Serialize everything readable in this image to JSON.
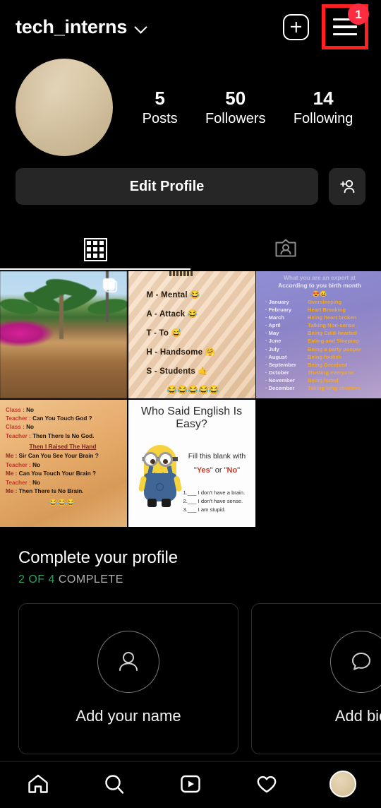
{
  "header": {
    "username": "tech_interns",
    "chevron_icon": "chevron-down-icon",
    "create_icon": "plus-square-icon",
    "menu_icon": "hamburger-menu-icon",
    "menu_badge": "1",
    "badge_color": "#ff2d41",
    "highlight_color": "#ff2020"
  },
  "profile": {
    "avatar_icon": "profile-avatar",
    "stats": [
      {
        "num": "5",
        "label": "Posts"
      },
      {
        "num": "50",
        "label": "Followers"
      },
      {
        "num": "14",
        "label": "Following"
      }
    ],
    "edit_profile_label": "Edit Profile",
    "add_person_icon": "add-person-icon"
  },
  "tabs": [
    {
      "name": "grid-tab",
      "icon": "grid-icon",
      "active": true
    },
    {
      "name": "tagged-tab",
      "icon": "person-card-icon",
      "active": false
    }
  ],
  "posts": [
    {
      "name": "post-tropical-photo",
      "type": "photo",
      "badge_icon": "carousel-icon"
    },
    {
      "name": "post-maths-acronym",
      "type": "text-meme",
      "lines": [
        "M - Mental 😂",
        "A - Attack 😂",
        "T - To 😅",
        "H - Handsome 🤗",
        "S - Students 🤙"
      ],
      "emojis": "😂😂😂😂😂"
    },
    {
      "name": "post-birth-month",
      "type": "text-meme",
      "header_line1": "What you are an expert at",
      "header_line2": "According to you birth month",
      "header_emojis": "😍😅",
      "rows": [
        {
          "month": "· January",
          "trait": "Oversleeping"
        },
        {
          "month": "· February",
          "trait": "Heart  Breaking"
        },
        {
          "month": "· March",
          "trait": "Being heart   broken"
        },
        {
          "month": "· April",
          "trait": "Talking Non-sense"
        },
        {
          "month": "· May",
          "trait": "Being Cold-hearted"
        },
        {
          "month": "· June",
          "trait": "Eating and Sleeping"
        },
        {
          "month": "· July",
          "trait": "Being a party pooper"
        },
        {
          "month": "· August",
          "trait": "Being foolish"
        },
        {
          "month": "· September",
          "trait": "Being Deceived"
        },
        {
          "month": "· October",
          "trait": "Trusting everyone"
        },
        {
          "month": "· November",
          "trait": "Being hated"
        },
        {
          "month": "· December",
          "trait": "Taking long showers"
        }
      ]
    },
    {
      "name": "post-teacher-joke",
      "type": "text-meme",
      "lines": [
        {
          "who": "Class : ",
          "text": "No"
        },
        {
          "who": "Teacher : ",
          "text": "Can You Touch God ?"
        },
        {
          "who": "Class : ",
          "text": "No"
        },
        {
          "who": "Teacher : ",
          "text": "Then There Is No God."
        }
      ],
      "middle": "Then I Raised The Hand",
      "lines2": [
        {
          "who": "Me : ",
          "text": "Sir Can You See Your Brain ?"
        },
        {
          "who": "Teacher : ",
          "text": "No"
        },
        {
          "who": "Me : ",
          "text": "Can You Touch Your Brain ?"
        },
        {
          "who": "Teacher : ",
          "text": "No"
        },
        {
          "who": "Me : ",
          "text": "Then There Is No Brain."
        }
      ],
      "emojis": "😂😂😂"
    },
    {
      "name": "post-english-easy",
      "type": "text-meme",
      "title": "Who Said English Is Easy?",
      "subtitle": "Fill this blank with",
      "yes": "Yes",
      "or": "or",
      "no": "No",
      "quote_open": "\"",
      "quote_close": "\"",
      "blanks": [
        "1.___ I don't have a brain.",
        "2.___ I don't have sense.",
        "3.___ I am stupid."
      ]
    }
  ],
  "complete_profile": {
    "title": "Complete your profile",
    "progress_done": "2 OF 4",
    "progress_rest": "COMPLETE",
    "progress_color": "#2f9e5c",
    "cards": [
      {
        "name": "add-your-name-card",
        "icon": "person-outline-icon",
        "label": "Add your name"
      },
      {
        "name": "add-bio-card",
        "icon": "speech-bubble-icon",
        "label": "Add bio"
      }
    ]
  },
  "bottom_nav": [
    {
      "name": "nav-home",
      "icon": "home-icon"
    },
    {
      "name": "nav-search",
      "icon": "search-icon"
    },
    {
      "name": "nav-reels",
      "icon": "reels-icon"
    },
    {
      "name": "nav-activity",
      "icon": "heart-icon"
    },
    {
      "name": "nav-profile",
      "icon": "profile-avatar-icon"
    }
  ]
}
